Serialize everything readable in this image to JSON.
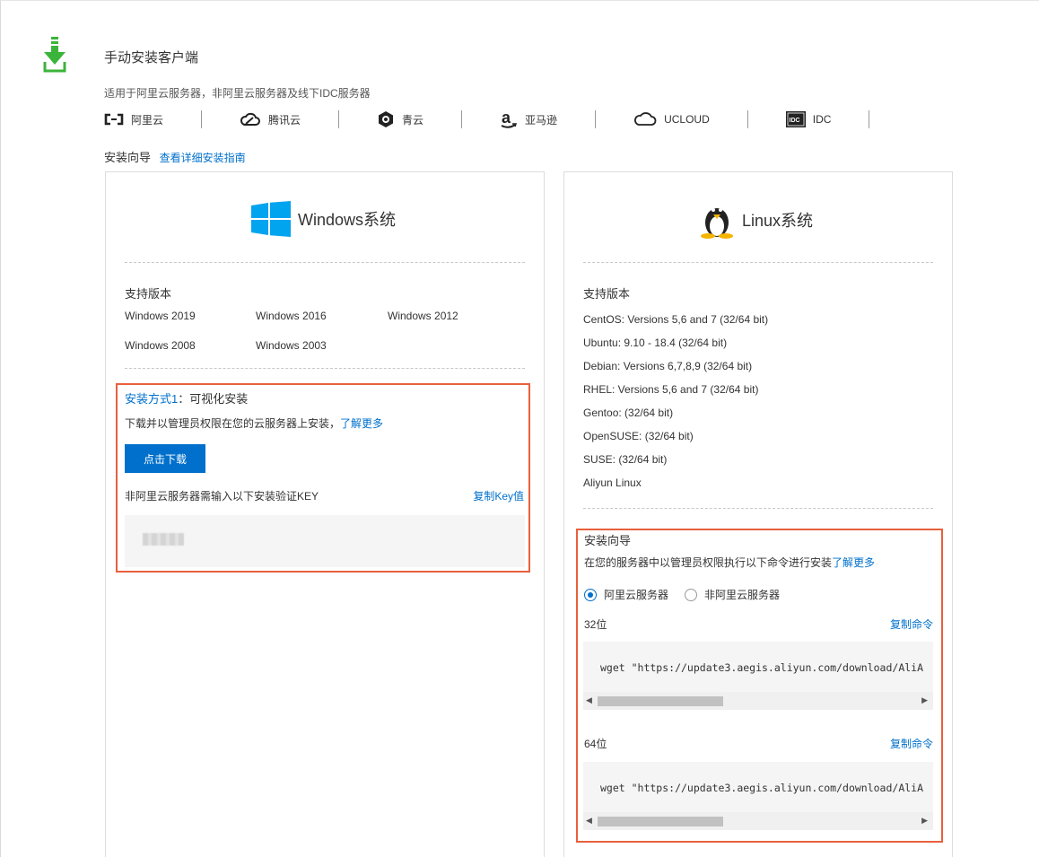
{
  "header": {
    "title": "手动安装客户端",
    "subtitle": "适用于阿里云服务器，非阿里云服务器及线下IDC服务器",
    "providers": [
      {
        "icon": "aliyun-icon",
        "label": "阿里云"
      },
      {
        "icon": "tencent-cloud-icon",
        "label": "腾讯云"
      },
      {
        "icon": "qingcloud-icon",
        "label": "青云"
      },
      {
        "icon": "amazon-icon",
        "label": "亚马逊"
      },
      {
        "icon": "ucloud-icon",
        "label": "UCLOUD"
      },
      {
        "icon": "idc-icon",
        "label": "IDC"
      }
    ],
    "guide_label": "安装向导",
    "guide_link": "查看详细安装指南"
  },
  "windows": {
    "title": "Windows系统",
    "supported_label": "支持版本",
    "versions": [
      "Windows 2019",
      "Windows 2016",
      "Windows 2012",
      "Windows 2008",
      "Windows 2003"
    ],
    "method_prefix": "安装方式1",
    "method_suffix": "：可视化安装",
    "description": "下载并以管理员权限在您的云服务器上安装，",
    "learn_more": "了解更多",
    "download_button": "点击下载",
    "key_label": "非阿里云服务器需输入以下安装验证KEY",
    "copy_key": "复制Key值"
  },
  "linux": {
    "title": "Linux系统",
    "supported_label": "支持版本",
    "versions": [
      "CentOS: Versions 5,6 and 7 (32/64 bit)",
      "Ubuntu: 9.10 - 18.4 (32/64 bit)",
      "Debian: Versions 6,7,8,9 (32/64 bit)",
      "RHEL: Versions 5,6 and 7 (32/64 bit)",
      "Gentoo: (32/64 bit)",
      "OpenSUSE: (32/64 bit)",
      "SUSE: (32/64 bit)",
      "Aliyun Linux"
    ],
    "guide_title": "安装向导",
    "guide_desc": "在您的服务器中以管理员权限执行以下命令进行安装",
    "learn_more": "了解更多",
    "radio_aliyun": "阿里云服务器",
    "radio_non_aliyun": "非阿里云服务器",
    "label_32": "32位",
    "label_64": "64位",
    "copy_command": "复制命令",
    "command_32": "wget \"https://update3.aegis.aliyun.com/download/AliA",
    "command_64": "wget \"https://update3.aegis.aliyun.com/download/AliA"
  },
  "colors": {
    "accent": "#0070cc",
    "highlight": "#e8603c",
    "download_green": "#3bb43b",
    "windows_blue": "#00a4ef"
  }
}
